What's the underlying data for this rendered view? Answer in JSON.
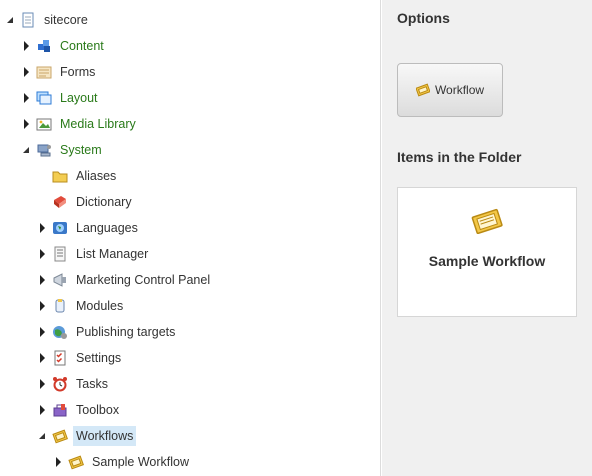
{
  "tree": {
    "root": {
      "label": "sitecore",
      "icon": "document-icon"
    },
    "items": [
      {
        "label": "Content",
        "icon": "content-icon",
        "color": "#2a7a1a"
      },
      {
        "label": "Forms",
        "icon": "forms-icon"
      },
      {
        "label": "Layout",
        "icon": "layout-icon",
        "color": "#2a7a1a"
      },
      {
        "label": "Media Library",
        "icon": "media-library-icon",
        "color": "#2a7a1a"
      },
      {
        "label": "System",
        "icon": "system-icon",
        "color": "#2a7a1a"
      }
    ],
    "system_children": [
      {
        "label": "Aliases",
        "icon": "folder-icon"
      },
      {
        "label": "Dictionary",
        "icon": "book-icon"
      },
      {
        "label": "Languages",
        "icon": "globe-icon"
      },
      {
        "label": "List Manager",
        "icon": "list-icon"
      },
      {
        "label": "Marketing Control Panel",
        "icon": "megaphone-icon"
      },
      {
        "label": "Modules",
        "icon": "modules-icon"
      },
      {
        "label": "Publishing targets",
        "icon": "publishing-icon"
      },
      {
        "label": "Settings",
        "icon": "checklist-icon"
      },
      {
        "label": "Tasks",
        "icon": "alarm-clock-icon"
      },
      {
        "label": "Toolbox",
        "icon": "toolbox-icon"
      },
      {
        "label": "Workflows",
        "icon": "workflow-icon"
      }
    ],
    "workflow_children": [
      {
        "label": "Sample Workflow",
        "icon": "workflow-icon"
      }
    ]
  },
  "options": {
    "title": "Options",
    "button_label": "Workflow"
  },
  "folder": {
    "title": "Items in the Folder",
    "item_label": "Sample Workflow"
  }
}
